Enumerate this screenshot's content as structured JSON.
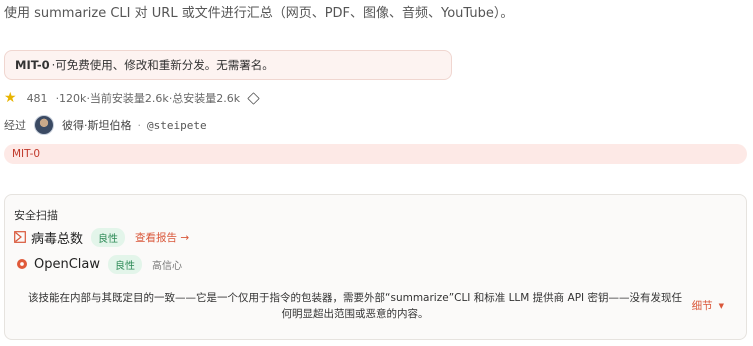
{
  "description": "使用 summarize CLI 对 URL 或文件进行汇总（网页、PDF、图像、音频、YouTube）。",
  "license_box": {
    "name": "MIT-0",
    "text": "·可免费使用、修改和重新分发。无需署名。"
  },
  "stats": {
    "stars": "481",
    "downloads": "·120k",
    "current_installs": "·当前安装量2.6k",
    "total_installs": "·总安装量2.6k"
  },
  "author": {
    "prefix": "经过",
    "name": "彼得·斯坦伯格",
    "separator": "·",
    "handle": "@steipete"
  },
  "license_tag": "MIT-0",
  "security": {
    "title": "安全扫描",
    "virustotal": {
      "name": "病毒总数",
      "verdict": "良性",
      "link": "查看报告 →"
    },
    "openclaw": {
      "name": "OpenClaw",
      "verdict": "良性",
      "confidence": "高信心"
    },
    "summary": "该技能在内部与其既定目的一致——它是一个仅用于指令的包装器，需要外部“summarize”CLI 和标准 LLM 提供商 API 密钥——没有发现任何明显超出范围或恶意的内容。",
    "details_label": "细节"
  },
  "colors": {
    "accent": "#d9573a",
    "benign_green": "#2e8b57",
    "star": "#e8b400"
  }
}
